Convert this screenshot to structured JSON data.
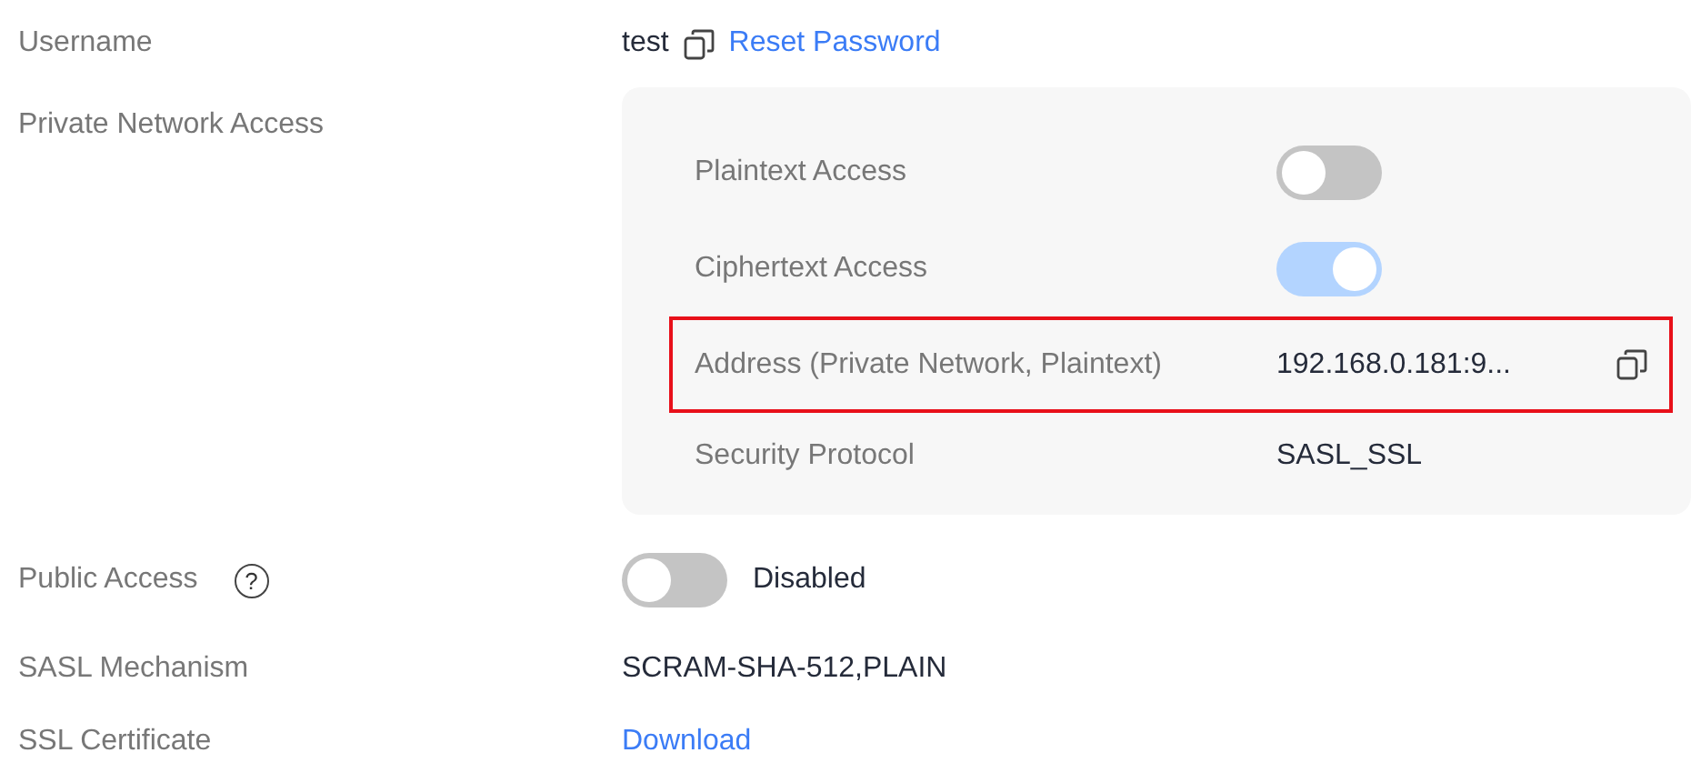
{
  "fields": [
    {
      "kind": "user",
      "label": "Username",
      "value": "test",
      "link": "Reset Password"
    },
    {
      "kind": "panel",
      "label": "Private Network Access",
      "rows": [
        {
          "kind": "toggle",
          "label": "Plaintext Access",
          "on": false,
          "disabled": false,
          "highlighted": false
        },
        {
          "kind": "toggle",
          "label": "Ciphertext Access",
          "on": true,
          "disabled": true,
          "highlighted": false
        },
        {
          "kind": "copy",
          "label": "Address (Private Network, Plaintext)",
          "value": "192.168.0.181:9...",
          "highlighted": true
        },
        {
          "kind": "text",
          "label": "Security Protocol",
          "value": "SASL_SSL",
          "highlighted": false
        }
      ]
    },
    {
      "kind": "toggle",
      "label": "Public Access",
      "help": "?",
      "on": false,
      "disabled": false,
      "status": "Disabled"
    },
    {
      "kind": "text",
      "label": "SASL Mechanism",
      "value": "SCRAM-SHA-512,PLAIN"
    },
    {
      "kind": "link",
      "label": "SSL Certificate",
      "link": "Download"
    }
  ]
}
